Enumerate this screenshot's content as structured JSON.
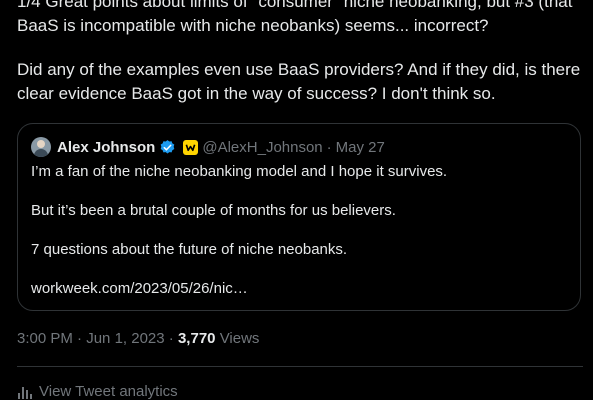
{
  "tweet": {
    "paragraphs": [
      "1/4 Great points about limits of \"consumer\" niche neobanking, but #3 (that BaaS is incompatible with niche neobanks) seems... incorrect?",
      "Did any of the examples even use BaaS providers? And if they did, is there clear evidence BaaS got in the way of success? I don't think so."
    ]
  },
  "quote": {
    "author_name": "Alex Johnson",
    "handle": "@AlexH_Johnson",
    "separator": "·",
    "date": "May 27",
    "paragraphs": [
      "I’m a fan of the niche neobanking model and I hope it survives.",
      "But it’s been a brutal couple of months for us believers.",
      "7 questions about the future of niche neobanks.",
      "workweek.com/2023/05/26/nic…"
    ],
    "icons": {
      "avatar": "user-avatar",
      "verified": "verified-badge-icon",
      "affiliation": "affiliation-badge-icon"
    },
    "colors": {
      "verified": "#1d9bf0",
      "affiliation": "#ffd400"
    }
  },
  "meta": {
    "time": "3:00 PM",
    "separator": "·",
    "date": "Jun 1, 2023",
    "separator2": "·",
    "views_count": "3,770",
    "views_label": "Views"
  },
  "analytics": {
    "label": "View Tweet analytics",
    "icon": "analytics-bars-icon"
  },
  "colors": {
    "background": "#000000",
    "text": "#e7e9ea",
    "muted": "#71767b",
    "border": "#2f3336"
  }
}
